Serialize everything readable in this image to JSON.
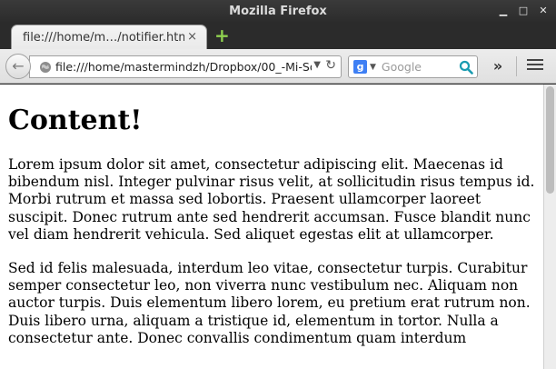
{
  "window": {
    "title": "Mozilla Firefox"
  },
  "tab": {
    "label": "file:///home/m…/notifier.html",
    "close": "×"
  },
  "newtab": "+",
  "navbar": {
    "url": "file:///home/mastermindzh/Dropbox/00_-Mi-So",
    "url_dropdown": "▼",
    "reload": "↻",
    "back": "←"
  },
  "search": {
    "placeholder": "Google",
    "engine": "g",
    "dropdown": "▼"
  },
  "overflow": "»",
  "content": {
    "heading": "Content!",
    "paragraphs": [
      "Lorem ipsum dolor sit amet, consectetur adipiscing elit. Maecenas id bibendum nisl. Integer pulvinar risus velit, at sollicitudin risus tempus id. Morbi rutrum et massa sed lobortis. Praesent ullamcorper laoreet suscipit. Donec rutrum ante sed hendrerit accumsan. Fusce blandit nunc vel diam hendrerit vehicula. Sed aliquet egestas elit at ullamcorper.",
      "Sed id felis malesuada, interdum leo vitae, consectetur turpis. Curabitur semper consectetur leo, non viverra nunc vestibulum nec. Aliquam non auctor turpis. Duis elementum libero lorem, eu pretium erat rutrum non. Duis libero urna, aliquam a tristique id, elementum in tortor. Nulla a consectetur ante. Donec convallis condimentum quam interdum"
    ]
  },
  "colors": {
    "newtab": "#8fd14f",
    "google_icon": "#3e7ff4",
    "search_icon": "#1a9bb0"
  }
}
